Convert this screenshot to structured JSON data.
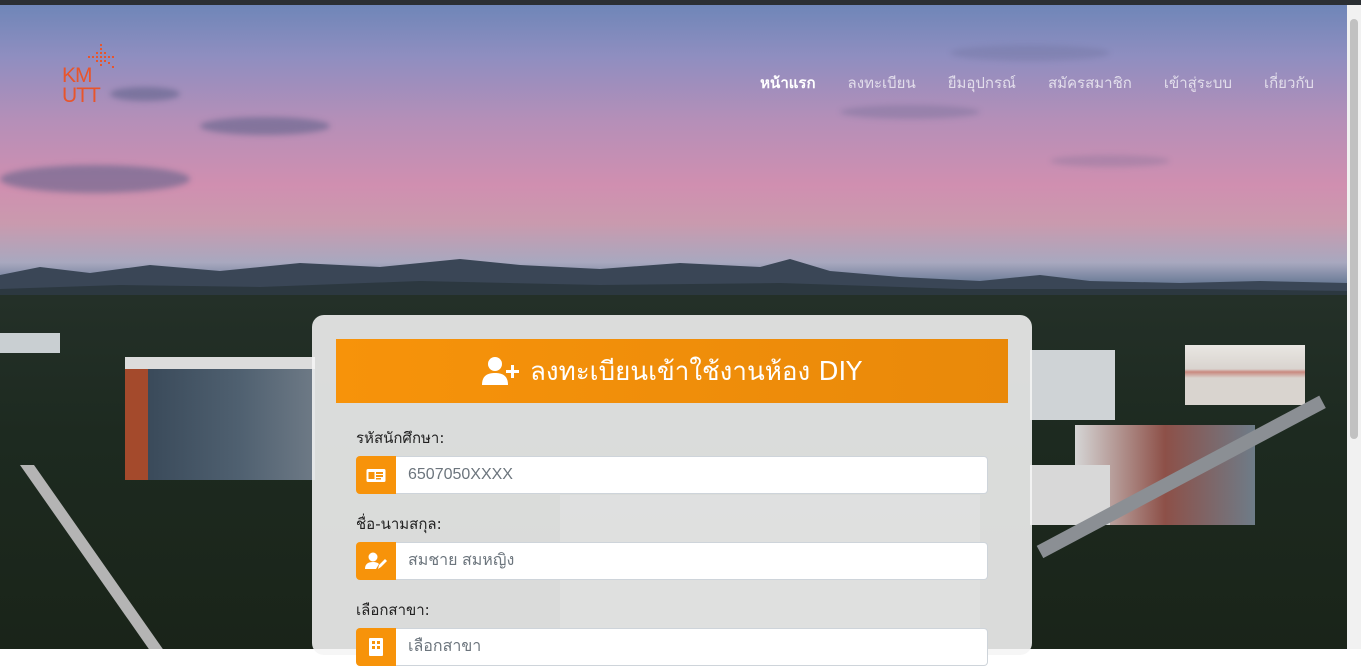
{
  "logo": {
    "text_line1": "KM",
    "text_line2": "UTT",
    "icon": "kmutt-logo"
  },
  "nav": {
    "items": [
      {
        "label": "หน้าแรก",
        "active": true
      },
      {
        "label": "ลงทะเบียน",
        "active": false
      },
      {
        "label": "ยืมอุปกรณ์",
        "active": false
      },
      {
        "label": "สมัครสมาชิก",
        "active": false
      },
      {
        "label": "เข้าสู่ระบบ",
        "active": false
      },
      {
        "label": "เกี่ยวกับ",
        "active": false
      }
    ]
  },
  "form": {
    "title": "ลงทะเบียนเข้าใช้งานห้อง DIY",
    "title_icon": "user-plus-icon",
    "student_id": {
      "label": "รหัสนักศึกษา:",
      "placeholder": "6507050XXXX",
      "icon": "id-card-icon"
    },
    "full_name": {
      "label": "ชื่อ-นามสกุล:",
      "placeholder": "สมชาย สมหญิง",
      "icon": "user-edit-icon"
    },
    "department": {
      "label": "เลือกสาขา:",
      "selected": "เลือกสาขา",
      "icon": "building-icon"
    }
  },
  "colors": {
    "accent": "#f7930a",
    "logo": "#e8552b",
    "topbar": "#2b2f33"
  }
}
